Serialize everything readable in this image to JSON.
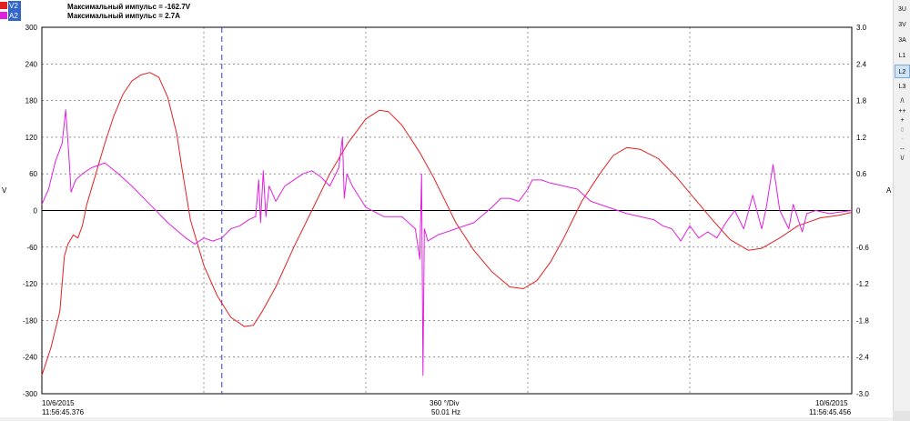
{
  "legend": [
    {
      "label": "V2",
      "color": "#e32020",
      "selected": true
    },
    {
      "label": "A2",
      "color": "#e020e0",
      "selected": true
    }
  ],
  "readouts": [
    "Максимальный импульс = -162.7V",
    "Максимальный импульс = 2.7A"
  ],
  "left_axis": {
    "unit": "V",
    "ticks": [
      "300",
      "240",
      "180",
      "120",
      "60",
      "0",
      "-60",
      "-120",
      "-180",
      "-240",
      "-300"
    ]
  },
  "right_axis": {
    "unit": "A",
    "ticks": [
      "3.0",
      "2.4",
      "1.8",
      "1.2",
      "0.6",
      "0",
      "-0.6",
      "-1.2",
      "-1.8",
      "-2.4",
      "-3.0"
    ]
  },
  "footer": {
    "start_date": "10/6/2015",
    "start_time": "11:56:45.376",
    "division": "360 °/Div",
    "frequency": "50.01 Hz",
    "end_date": "10/6/2015",
    "end_time": "11:56:45.456"
  },
  "toolbar": [
    {
      "label": "3U",
      "name": "3u-button",
      "size": "big",
      "active": false,
      "disabled": false
    },
    {
      "label": "3V",
      "name": "3v-button",
      "size": "big",
      "active": false,
      "disabled": false
    },
    {
      "label": "3A",
      "name": "3a-button",
      "size": "big",
      "active": false,
      "disabled": false
    },
    {
      "label": "L1",
      "name": "l1-button",
      "size": "big",
      "active": false,
      "disabled": false
    },
    {
      "label": "L2",
      "name": "l2-button",
      "size": "big",
      "active": true,
      "disabled": false
    },
    {
      "label": "L3",
      "name": "l3-button",
      "size": "big",
      "active": false,
      "disabled": false
    },
    {
      "label": "/\\",
      "name": "scale-up-button",
      "size": "small",
      "active": false,
      "disabled": false
    },
    {
      "label": "++",
      "name": "zoom-in-more-button",
      "size": "small",
      "active": false,
      "disabled": false
    },
    {
      "label": "+",
      "name": "zoom-in-button",
      "size": "small",
      "active": false,
      "disabled": false
    },
    {
      "label": "0",
      "name": "reset-zoom-button",
      "size": "small",
      "active": false,
      "disabled": true
    },
    {
      "label": "-",
      "name": "zoom-out-button",
      "size": "small",
      "active": false,
      "disabled": true
    },
    {
      "label": "--",
      "name": "zoom-out-more-button",
      "size": "small",
      "active": false,
      "disabled": false
    },
    {
      "label": "\\/",
      "name": "scale-down-button",
      "size": "small",
      "active": false,
      "disabled": false
    }
  ],
  "chart_data": {
    "type": "line",
    "grid": true,
    "x_range_degrees": [
      0,
      1800
    ],
    "x_division_degrees": 360,
    "vertical_cursor_degrees": 400,
    "series": [
      {
        "name": "V2",
        "color": "#e32020",
        "axis": "left",
        "ylim": [
          -300,
          300
        ],
        "points": [
          [
            0,
            -270
          ],
          [
            20,
            -225
          ],
          [
            40,
            -165
          ],
          [
            50,
            -75
          ],
          [
            58,
            -55
          ],
          [
            70,
            -40
          ],
          [
            80,
            -45
          ],
          [
            90,
            -25
          ],
          [
            100,
            10
          ],
          [
            120,
            60
          ],
          [
            140,
            110
          ],
          [
            160,
            155
          ],
          [
            180,
            190
          ],
          [
            200,
            212
          ],
          [
            220,
            222
          ],
          [
            240,
            226
          ],
          [
            260,
            218
          ],
          [
            280,
            185
          ],
          [
            300,
            125
          ],
          [
            310,
            75
          ],
          [
            330,
            -15
          ],
          [
            360,
            -90
          ],
          [
            390,
            -140
          ],
          [
            420,
            -175
          ],
          [
            450,
            -190
          ],
          [
            470,
            -188
          ],
          [
            490,
            -165
          ],
          [
            520,
            -125
          ],
          [
            560,
            -60
          ],
          [
            600,
            0
          ],
          [
            640,
            60
          ],
          [
            680,
            110
          ],
          [
            720,
            150
          ],
          [
            750,
            164
          ],
          [
            770,
            162
          ],
          [
            800,
            140
          ],
          [
            840,
            95
          ],
          [
            870,
            55
          ],
          [
            890,
            25
          ],
          [
            920,
            -20
          ],
          [
            960,
            -65
          ],
          [
            1000,
            -100
          ],
          [
            1040,
            -125
          ],
          [
            1070,
            -128
          ],
          [
            1100,
            -115
          ],
          [
            1130,
            -85
          ],
          [
            1160,
            -45
          ],
          [
            1200,
            15
          ],
          [
            1240,
            60
          ],
          [
            1270,
            90
          ],
          [
            1300,
            103
          ],
          [
            1330,
            100
          ],
          [
            1370,
            85
          ],
          [
            1410,
            55
          ],
          [
            1450,
            20
          ],
          [
            1490,
            -15
          ],
          [
            1530,
            -48
          ],
          [
            1570,
            -65
          ],
          [
            1600,
            -62
          ],
          [
            1640,
            -45
          ],
          [
            1680,
            -25
          ],
          [
            1730,
            -12
          ],
          [
            1770,
            -8
          ],
          [
            1800,
            -3
          ]
        ]
      },
      {
        "name": "A2",
        "color": "#e020e0",
        "axis": "right",
        "ylim": [
          -3,
          3
        ],
        "points": [
          [
            0,
            0.1
          ],
          [
            15,
            0.35
          ],
          [
            30,
            0.8
          ],
          [
            45,
            1.1
          ],
          [
            53,
            1.65
          ],
          [
            60,
            0.9
          ],
          [
            65,
            0.3
          ],
          [
            75,
            0.5
          ],
          [
            90,
            0.6
          ],
          [
            110,
            0.7
          ],
          [
            140,
            0.78
          ],
          [
            170,
            0.6
          ],
          [
            200,
            0.4
          ],
          [
            240,
            0.1
          ],
          [
            280,
            -0.2
          ],
          [
            320,
            -0.45
          ],
          [
            340,
            -0.55
          ],
          [
            360,
            -0.45
          ],
          [
            380,
            -0.5
          ],
          [
            400,
            -0.45
          ],
          [
            420,
            -0.3
          ],
          [
            440,
            -0.25
          ],
          [
            460,
            -0.15
          ],
          [
            475,
            -0.1
          ],
          [
            482,
            0.5
          ],
          [
            486,
            -0.2
          ],
          [
            492,
            0.65
          ],
          [
            498,
            -0.1
          ],
          [
            505,
            0.4
          ],
          [
            520,
            0.15
          ],
          [
            540,
            0.4
          ],
          [
            560,
            0.5
          ],
          [
            580,
            0.6
          ],
          [
            600,
            0.65
          ],
          [
            620,
            0.55
          ],
          [
            640,
            0.4
          ],
          [
            660,
            0.7
          ],
          [
            668,
            1.2
          ],
          [
            672,
            0.2
          ],
          [
            678,
            0.6
          ],
          [
            690,
            0.4
          ],
          [
            720,
            0.05
          ],
          [
            760,
            -0.1
          ],
          [
            800,
            -0.1
          ],
          [
            830,
            -0.3
          ],
          [
            840,
            -0.8
          ],
          [
            844,
            0.6
          ],
          [
            847,
            -2.7
          ],
          [
            850,
            -0.3
          ],
          [
            858,
            -0.5
          ],
          [
            880,
            -0.4
          ],
          [
            920,
            -0.3
          ],
          [
            960,
            -0.2
          ],
          [
            1000,
            0.05
          ],
          [
            1020,
            0.2
          ],
          [
            1040,
            0.2
          ],
          [
            1060,
            0.15
          ],
          [
            1080,
            0.35
          ],
          [
            1090,
            0.5
          ],
          [
            1110,
            0.5
          ],
          [
            1130,
            0.45
          ],
          [
            1160,
            0.4
          ],
          [
            1190,
            0.35
          ],
          [
            1220,
            0.15
          ],
          [
            1260,
            0.05
          ],
          [
            1300,
            -0.05
          ],
          [
            1330,
            -0.1
          ],
          [
            1360,
            -0.15
          ],
          [
            1380,
            -0.25
          ],
          [
            1400,
            -0.3
          ],
          [
            1420,
            -0.5
          ],
          [
            1440,
            -0.25
          ],
          [
            1460,
            -0.45
          ],
          [
            1480,
            -0.35
          ],
          [
            1500,
            -0.45
          ],
          [
            1520,
            -0.2
          ],
          [
            1540,
            0.0
          ],
          [
            1560,
            -0.3
          ],
          [
            1580,
            0.25
          ],
          [
            1600,
            -0.3
          ],
          [
            1610,
            0.05
          ],
          [
            1625,
            0.75
          ],
          [
            1640,
            0.0
          ],
          [
            1660,
            -0.3
          ],
          [
            1670,
            0.1
          ],
          [
            1690,
            -0.35
          ],
          [
            1700,
            -0.05
          ],
          [
            1720,
            0.0
          ],
          [
            1750,
            -0.05
          ],
          [
            1780,
            -0.02
          ],
          [
            1800,
            0.0
          ]
        ]
      }
    ]
  }
}
